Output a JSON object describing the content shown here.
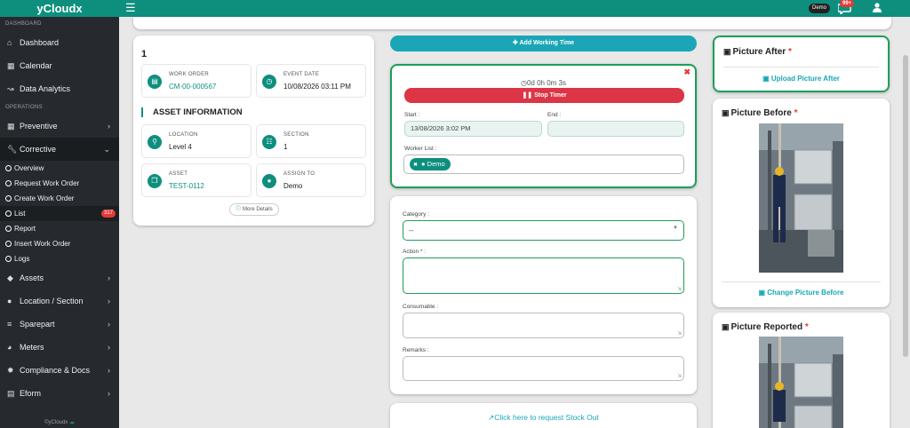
{
  "topbar": {
    "brand": "yCloudx",
    "hamburger_icon": "hamburger-icon",
    "user_pill": "Demo",
    "notif_count": "99+"
  },
  "sidebar": {
    "section_dashboard": "DASHBOARD",
    "section_operations": "OPERATIONS",
    "items": [
      {
        "label": "Dashboard",
        "icon": "home-icon"
      },
      {
        "label": "Calendar",
        "icon": "calendar-icon"
      },
      {
        "label": "Data Analytics",
        "icon": "chart-icon"
      },
      {
        "label": "Preventive",
        "icon": "calendar-check-icon"
      },
      {
        "label": "Corrective",
        "icon": "wrench-icon"
      },
      {
        "label": "Assets",
        "icon": "tag-icon"
      },
      {
        "label": "Location / Section",
        "icon": "globe-icon"
      },
      {
        "label": "Sparepart",
        "icon": "dolly-icon"
      },
      {
        "label": "Meters",
        "icon": "gauge-icon"
      },
      {
        "label": "Compliance & Docs",
        "icon": "certificate-icon"
      },
      {
        "label": "Eform",
        "icon": "form-icon"
      }
    ],
    "sub_items": [
      {
        "label": "Overview"
      },
      {
        "label": "Request Work Order"
      },
      {
        "label": "Create Work Order"
      },
      {
        "label": "List",
        "badge": "317"
      },
      {
        "label": "Report"
      },
      {
        "label": "Insert Work Order"
      },
      {
        "label": "Logs"
      }
    ],
    "footer": "©yCloudx"
  },
  "work_order": {
    "number": "1",
    "work_order_label": "WORK ORDER",
    "work_order_value": "CM-00-000567",
    "event_date_label": "EVENT DATE",
    "event_date_value": "10/08/2026 03:11 PM",
    "asset_info_heading": "ASSET INFORMATION",
    "location_label": "LOCATION",
    "location_value": "Level 4",
    "section_label": "SECTION",
    "section_value": "1",
    "asset_label": "ASSET",
    "asset_value": "TEST-0112",
    "assign_label": "ASSIGN TO",
    "assign_value": "Demo",
    "more_details": "More Details"
  },
  "timer": {
    "add_working_time": "Add Working Time",
    "elapsed": "0d 0h 0m 3s",
    "stop_timer": "Stop Timer",
    "start_label": "Start :",
    "start_value": "13/08/2026 3:02 PM",
    "end_label": "End :",
    "end_value": "",
    "worker_list_label": "Worker List :",
    "worker": "Demo"
  },
  "form": {
    "category_label": "Category :",
    "category_value": "--",
    "action_label": "Action * :",
    "consumable_label": "Consumable :",
    "remarks_label": "Remarks :",
    "stock_out_link": "Click here to request Stock Out"
  },
  "pictures": {
    "after_title": "Picture After",
    "after_upload": "Upload Picture After",
    "before_title": "Picture Before",
    "before_change": "Change Picture Before",
    "reported_title": "Picture Reported",
    "required_mark": "*"
  },
  "colors": {
    "brand_teal": "#0e8f7e",
    "link_cyan": "#1aa6b7",
    "danger_red": "#dc3545",
    "success_green": "#1e9e5a",
    "sidebar_bg": "#262a2e"
  }
}
